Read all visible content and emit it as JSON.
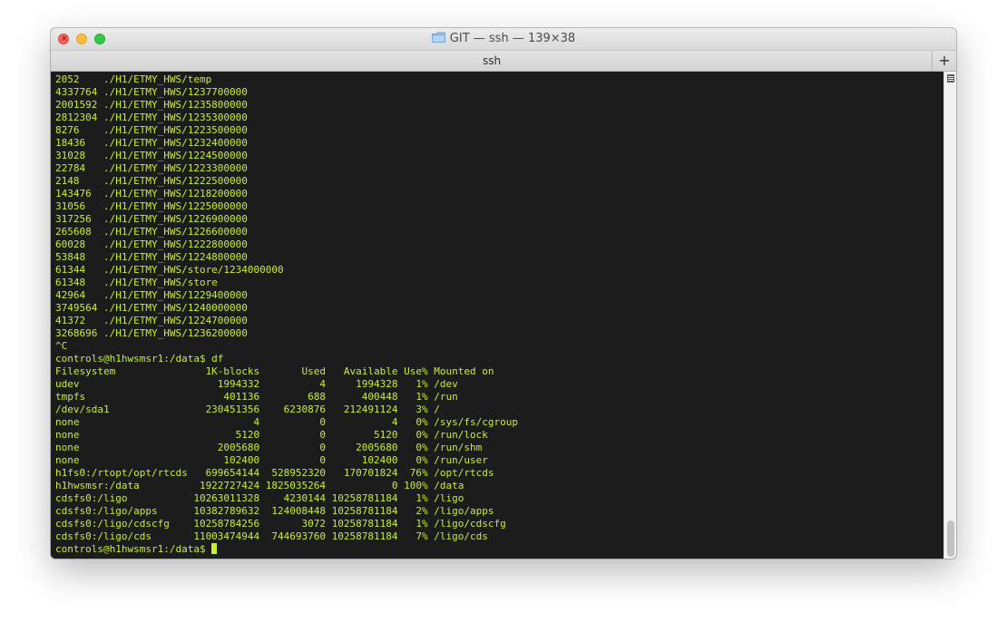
{
  "window": {
    "title": "GIT — ssh — 139×38",
    "folder_icon": "folder-icon"
  },
  "tabbar": {
    "tab_label": "ssh",
    "new_tab_label": "+"
  },
  "terminal": {
    "lines": [
      "2052    ./H1/ETMY_HWS/temp",
      "4337764 ./H1/ETMY_HWS/1237700000",
      "2001592 ./H1/ETMY_HWS/1235800000",
      "2812304 ./H1/ETMY_HWS/1235300000",
      "8276    ./H1/ETMY_HWS/1223500000",
      "18436   ./H1/ETMY_HWS/1232400000",
      "31028   ./H1/ETMY_HWS/1224500000",
      "22784   ./H1/ETMY_HWS/1223300000",
      "2148    ./H1/ETMY_HWS/1222500000",
      "143476  ./H1/ETMY_HWS/1218200000",
      "31056   ./H1/ETMY_HWS/1225000000",
      "317256  ./H1/ETMY_HWS/1226900000",
      "265608  ./H1/ETMY_HWS/1226600000",
      "60028   ./H1/ETMY_HWS/1222800000",
      "53848   ./H1/ETMY_HWS/1224800000",
      "61344   ./H1/ETMY_HWS/store/1234000000",
      "61348   ./H1/ETMY_HWS/store",
      "42964   ./H1/ETMY_HWS/1229400000",
      "3749564 ./H1/ETMY_HWS/1240000000",
      "41372   ./H1/ETMY_HWS/1224700000",
      "3268696 ./H1/ETMY_HWS/1236200000",
      "^C",
      "controls@h1hwsmsr1:/data$ df",
      "Filesystem               1K-blocks       Used   Available Use% Mounted on",
      "udev                       1994332          4     1994328   1% /dev",
      "tmpfs                       401136        688      400448   1% /run",
      "/dev/sda1                230451356    6230876   212491124   3% /",
      "none                             4          0           4   0% /sys/fs/cgroup",
      "none                          5120          0        5120   0% /run/lock",
      "none                       2005680          0     2005680   0% /run/shm",
      "none                        102400          0      102400   0% /run/user",
      "h1fs0:/rtopt/opt/rtcds   699654144  528952320   170701824  76% /opt/rtcds",
      "h1hwsmsr:/data          1922727424 1825035264           0 100% /data",
      "cdsfs0:/ligo           10263011328    4230144 10258781184   1% /ligo",
      "cdsfs0:/ligo/apps      10382789632  124008448 10258781184   2% /ligo/apps",
      "cdsfs0:/ligo/cdscfg    10258784256       3072 10258781184   1% /ligo/cdscfg",
      "cdsfs0:/ligo/cds       11003474944  744693760 10258781184   7% /ligo/cds"
    ],
    "prompt": "controls@h1hwsmsr1:/data$ ",
    "text_color": "#c8f02a",
    "background_color": "#1c1c1c"
  },
  "colors": {
    "close": "#fc605c",
    "minimize": "#fdbc40",
    "zoom": "#34c84a"
  }
}
